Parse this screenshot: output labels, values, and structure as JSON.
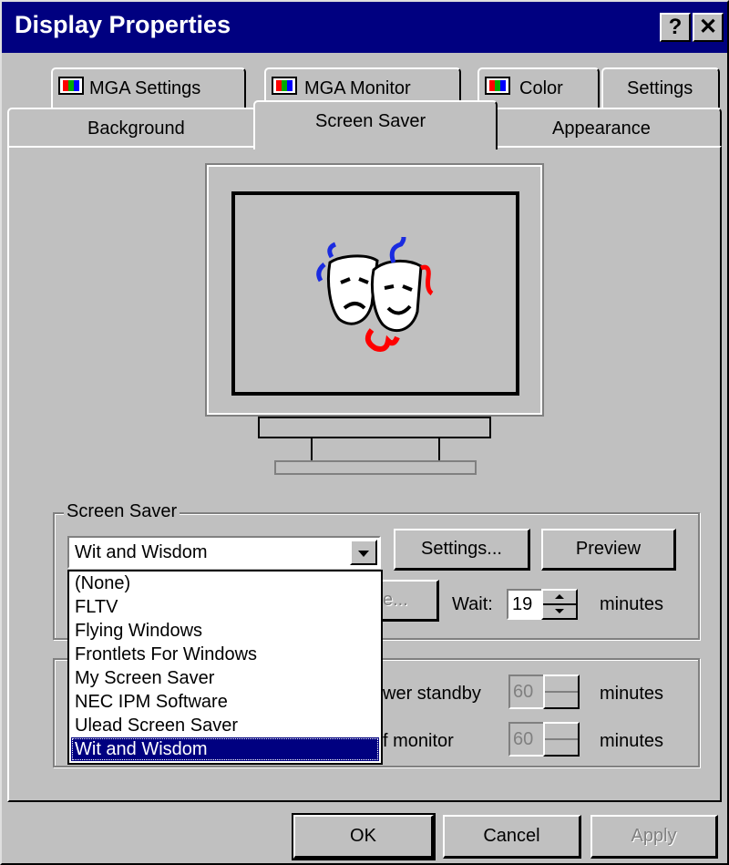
{
  "window": {
    "title": "Display Properties",
    "help_label": "?",
    "close_label": "✕"
  },
  "tabs_back": [
    {
      "label": "MGA Settings",
      "icon": "mga-icon"
    },
    {
      "label": "MGA Monitor",
      "icon": "mga-icon"
    },
    {
      "label": "Color",
      "icon": "mga-icon"
    },
    {
      "label": "Settings"
    }
  ],
  "tabs_front": [
    {
      "label": "Background"
    },
    {
      "label": "Screen Saver",
      "active": true
    },
    {
      "label": "Appearance"
    }
  ],
  "screensaver": {
    "group_label": "Screen Saver",
    "selected": "Wit and Wisdom",
    "settings_label": "Settings...",
    "preview_label": "Preview",
    "password_partial": "e...",
    "wait_label": "Wait:",
    "wait_value": "19",
    "minutes_label": "minutes",
    "options": [
      "(None)",
      "FLTV",
      "Flying Windows",
      "Frontlets For Windows",
      "My Screen Saver",
      "NEC IPM Software",
      "Ulead Screen Saver",
      "Wit and Wisdom"
    ],
    "selected_index": 7
  },
  "energy": {
    "standby_partial": "wer standby",
    "standby_value": "60",
    "monitor_partial": "f monitor",
    "monitor_value": "60",
    "minutes_label": "minutes"
  },
  "footer": {
    "ok_label": "OK",
    "cancel_label": "Cancel",
    "apply_label": "Apply"
  },
  "colors": {
    "titlebar": "#000080",
    "face": "#c0c0c0",
    "selection": "#000080"
  }
}
